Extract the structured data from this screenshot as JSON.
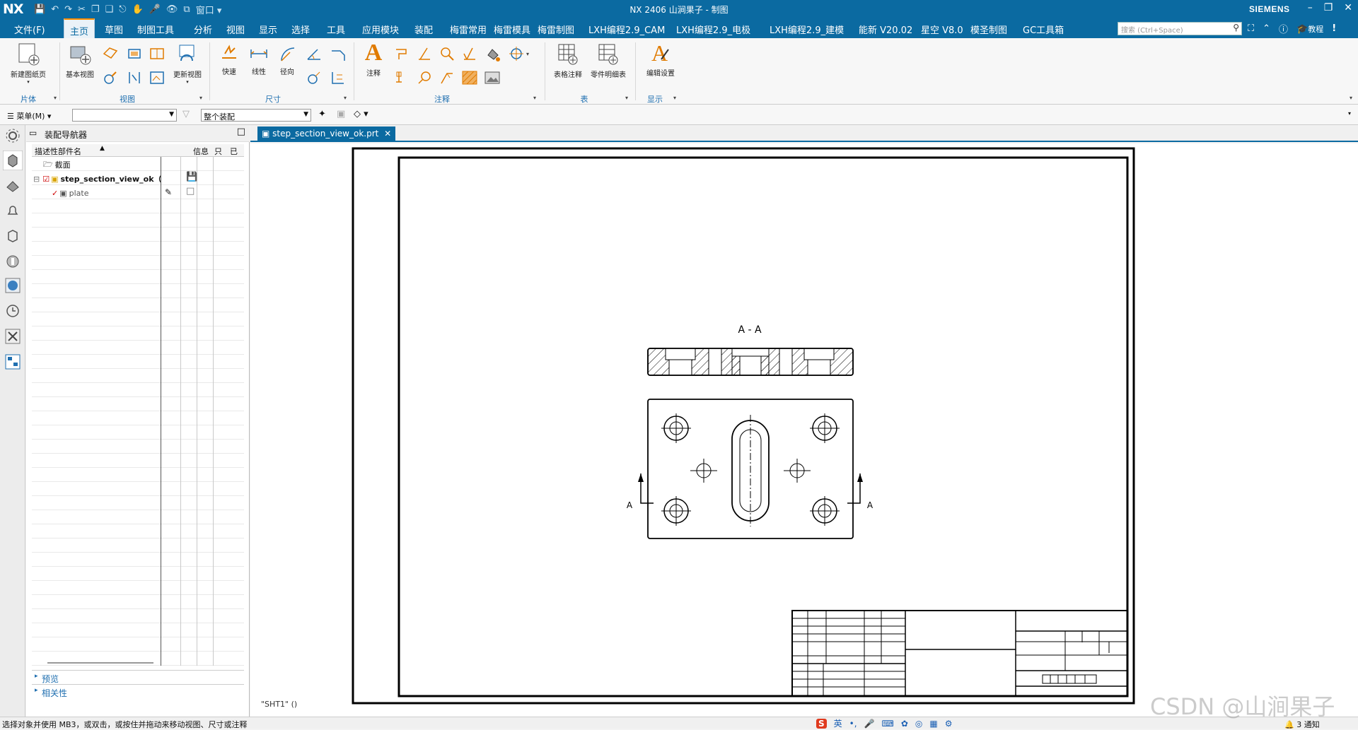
{
  "app": {
    "logo": "NX",
    "title": "NX 2406 山涧果子 - 制图",
    "brand": "SIEMENS",
    "window_menu": "窗口"
  },
  "menu": {
    "file": "文件(F)",
    "items": [
      "主页",
      "草图",
      "制图工具",
      "分析",
      "视图",
      "显示",
      "选择",
      "工具",
      "应用模块",
      "装配",
      "梅雷常用",
      "梅雷模具",
      "梅雷制图",
      "LXH编程2.9_CAM",
      "LXH编程2.9_电极",
      "LXH编程2.9_建模",
      "能新 V20.02",
      "星空 V8.0",
      "模圣制图",
      "GC工具箱"
    ],
    "search_placeholder": "搜索 (Ctrl+Space)",
    "tutorial": "教程"
  },
  "ribbon": {
    "new_sheet": "新建图纸页",
    "base_view": "基本视图",
    "update_views": "更新视图",
    "rapid": "快速",
    "linear": "线性",
    "radial": "径向",
    "note": "注释",
    "table_note": "表格注释",
    "parts_list": "零件明细表",
    "edit_settings": "编辑设置",
    "groups": [
      "片体",
      "视图",
      "尺寸",
      "注释",
      "表",
      "显示"
    ]
  },
  "command_bar": {
    "menu_label": "菜单(M)",
    "filter_value": "",
    "scope_value": "整个装配"
  },
  "navigator": {
    "title": "装配导航器",
    "col_name": "描述性部件名",
    "col_info": "信息",
    "col_readonly": "只",
    "col_mod": "已",
    "rows": [
      {
        "name": "截面"
      },
      {
        "name": "step_section_view_ok（顺..."
      },
      {
        "name": "plate"
      }
    ],
    "preview": "预览",
    "dependencies": "相关性"
  },
  "tab": {
    "label": "step_section_view_ok.prt"
  },
  "drawing": {
    "section_label": "A - A",
    "cut_label_left": "A",
    "cut_label_right": "A",
    "sheet_label": "\"SHT1\" ()"
  },
  "status": {
    "message": "选择对象并使用 MB3，或双击，或按住并拖动来移动视图、尺寸或注释",
    "ime_lang": "英",
    "notifications": "3 通知"
  },
  "watermark": "CSDN @山涧果子",
  "colors": {
    "title_bar": "#0b6aa1",
    "accent_orange": "#ff8c00",
    "ribbon_icon_orange": "#e07b00",
    "ribbon_icon_blue": "#1f6fb0"
  }
}
